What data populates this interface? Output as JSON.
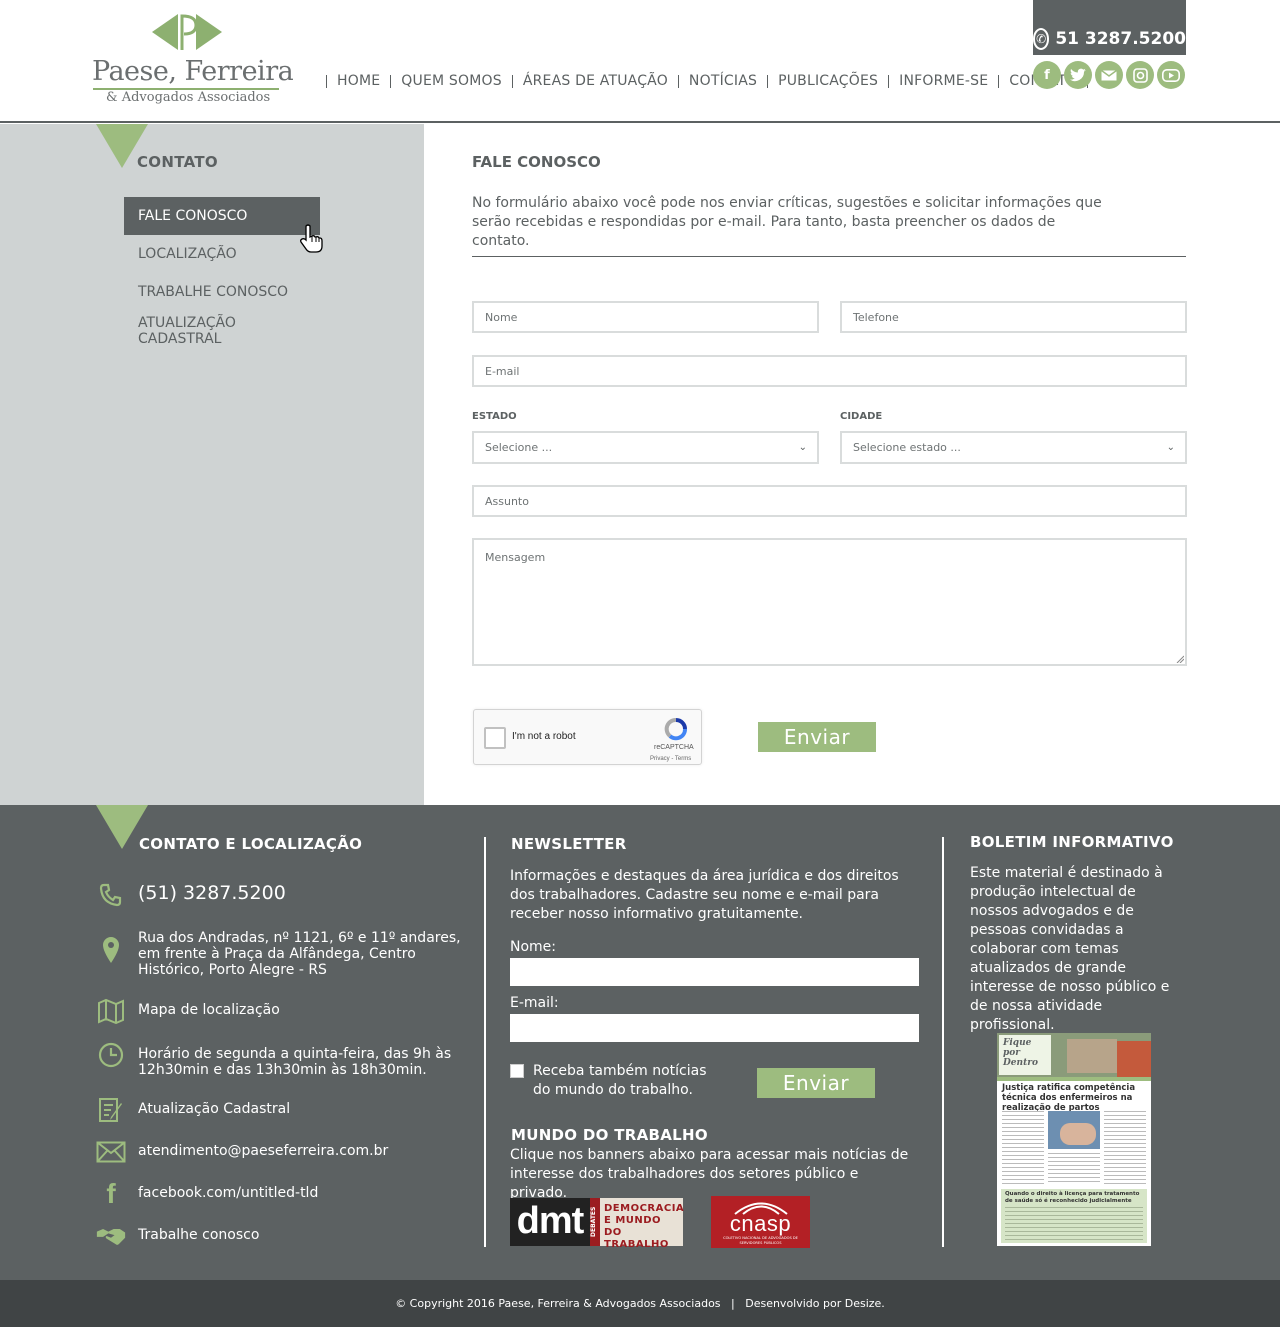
{
  "header": {
    "logo_name": "Paese, Ferreira",
    "logo_sub": "& Advogados Associados",
    "nav": [
      "HOME",
      "QUEM SOMOS",
      "ÁREAS DE ATUAÇÃO",
      "NOTÍCIAS",
      "PUBLICAÇÕES",
      "INFORME-SE",
      "CONTATO"
    ],
    "phone": "51 3287.5200",
    "socials": [
      "facebook-icon",
      "twitter-icon",
      "email-icon",
      "instagram-icon",
      "youtube-icon"
    ]
  },
  "sidebar": {
    "title": "CONTATO",
    "items": [
      {
        "label": "FALE CONOSCO",
        "active": true
      },
      {
        "label": "LOCALIZAÇÃO",
        "active": false
      },
      {
        "label": "TRABALHE CONOSCO",
        "active": false
      },
      {
        "label": "ATUALIZAÇÃO CADASTRAL",
        "active": false
      }
    ]
  },
  "form": {
    "title": "FALE CONOSCO",
    "description": "No formulário abaixo você pode nos enviar críticas, sugestões e solicitar informações que serão recebidas e respondidas por e-mail. Para tanto, basta preencher os dados de contato.",
    "nome_placeholder": "Nome",
    "telefone_placeholder": "Telefone",
    "email_placeholder": "E-mail",
    "estado_label": "ESTADO",
    "estado_value": "Selecione ...",
    "cidade_label": "CIDADE",
    "cidade_value": "Selecione estado ...",
    "assunto_placeholder": "Assunto",
    "mensagem_placeholder": "Mensagem",
    "captcha_label": "I'm not a robot",
    "captcha_brand": "reCAPTCHA",
    "captcha_terms": "Privacy - Terms",
    "submit_label": "Enviar"
  },
  "footer": {
    "contact": {
      "title": "CONTATO E LOCALIZAÇÃO",
      "phone": "(51) 3287.5200",
      "address": "Rua dos Andradas, nº 1121, 6º e 11º andares, em frente à Praça da Alfândega, Centro Histórico, Porto Alegre - RS",
      "map": "Mapa de localização",
      "hours": "Horário de segunda a quinta-feira, das 9h às 12h30min e das 13h30min às 18h30min.",
      "update": "Atualização Cadastral",
      "email": "atendimento@paeseferreira.com.br",
      "facebook": "facebook.com/untitled-tld",
      "work": "Trabalhe conosco"
    },
    "newsletter": {
      "title": "NEWSLETTER",
      "text": "Informações e destaques da área jurídica e dos direitos dos trabalhadores. Cadastre seu nome e e-mail para receber nosso informativo gratuitamente.",
      "nome_label": "Nome:",
      "email_label": "E-mail:",
      "checkbox_label": "Receba também notícias do mundo do trabalho.",
      "submit_label": "Enviar",
      "mundo_title": "MUNDO DO TRABALHO",
      "mundo_text": "Clique nos banners abaixo para acessar mais notícias de interesse dos trabalhadores dos setores público e privado.",
      "dmt_label": "dmt",
      "dmt_side": "DEBATES",
      "dmt_text": "DEMOCRACIA E MUNDO DO TRABALHO",
      "cnasp_label": "cnasp",
      "cnasp_sub": "COLETIVO NACIONAL DE ADVOGADOS DE SERVIDORES PÚBLICOS"
    },
    "bulletin": {
      "title": "BOLETIM INFORMATIVO",
      "text": "Este material é destinado à produção intelectual de nossos advogados e de pessoas convidadas a colaborar com temas atualizados de grande interesse de nosso público e de nossa atividade profissional.",
      "cover_masthead": "Fique por Dentro",
      "cover_headline": "Justiça ratifica competência técnica dos enfermeiros na realização de partos",
      "cover_box": "Quando o direito à licença para tratamento de saúde só é reconhecido judicialmente"
    },
    "copyright": "© Copyright 2016 Paese, Ferreira & Advogados Associados   |   Desenvolvido por Desize."
  },
  "colors": {
    "accent": "#9dbc7f",
    "dark": "#5c6162",
    "sidebar": "#cfd3d3",
    "bottom": "#404445"
  }
}
